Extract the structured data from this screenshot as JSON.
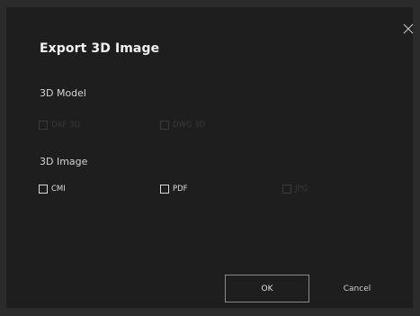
{
  "dialog": {
    "title": "Export 3D Image",
    "close_icon": "close-icon"
  },
  "model_section": {
    "label": "3D Model",
    "options": [
      {
        "label": "DXF 3D",
        "checked": false,
        "enabled": false
      },
      {
        "label": "DWG 3D",
        "checked": false,
        "enabled": false
      }
    ]
  },
  "image_section": {
    "label": "3D Image",
    "options": [
      {
        "label": "CMI",
        "checked": false,
        "enabled": true
      },
      {
        "label": "PDF",
        "checked": false,
        "enabled": true
      },
      {
        "label": "JPG",
        "checked": false,
        "enabled": false
      }
    ]
  },
  "buttons": {
    "ok_label": "OK",
    "cancel_label": "Cancel"
  },
  "colors": {
    "background": "#1e1e1e",
    "text": "#f2f2f2",
    "disabled": "#3a3a3a"
  }
}
